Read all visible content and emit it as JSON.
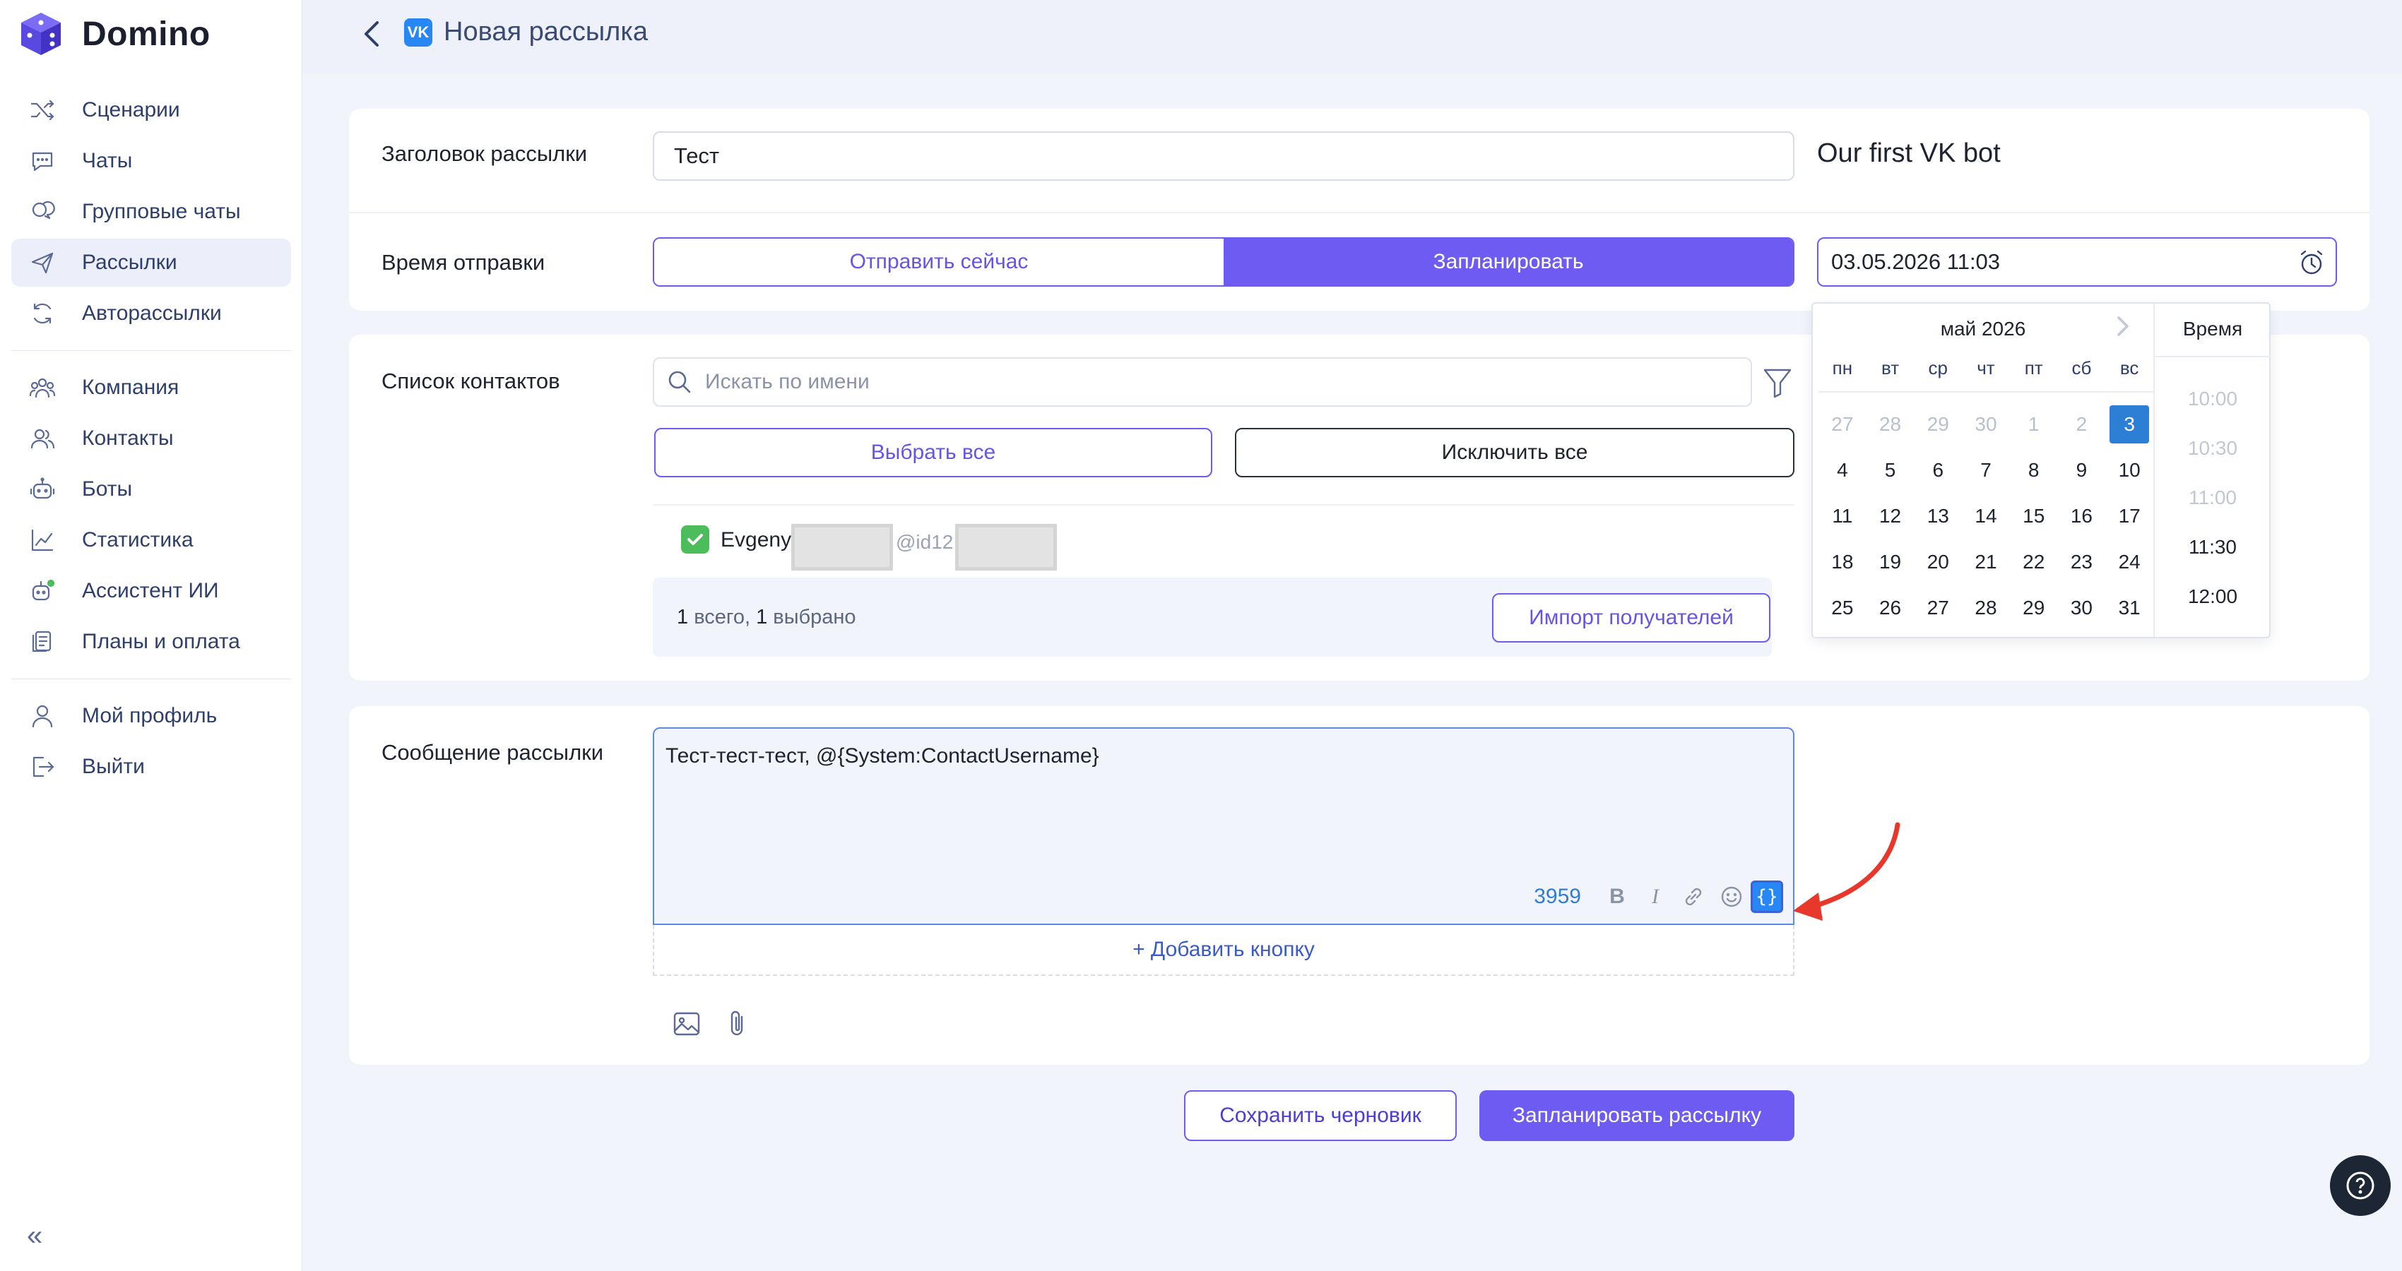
{
  "app": {
    "name": "Domino"
  },
  "sidebar": {
    "items": [
      {
        "label": "Сценарии",
        "icon": "shuffle-icon"
      },
      {
        "label": "Чаты",
        "icon": "chat-icon"
      },
      {
        "label": "Групповые чаты",
        "icon": "group-chat-icon"
      },
      {
        "label": "Рассылки",
        "icon": "send-icon",
        "active": true
      },
      {
        "label": "Авторассылки",
        "icon": "auto-send-icon"
      },
      {
        "label": "Компания",
        "icon": "company-icon"
      },
      {
        "label": "Контакты",
        "icon": "contacts-icon"
      },
      {
        "label": "Боты",
        "icon": "bot-icon"
      },
      {
        "label": "Статистика",
        "icon": "stats-icon"
      },
      {
        "label": "Ассистент ИИ",
        "icon": "ai-assistant-icon"
      },
      {
        "label": "Планы и оплата",
        "icon": "billing-icon"
      },
      {
        "label": "Мой профиль",
        "icon": "profile-icon"
      },
      {
        "label": "Выйти",
        "icon": "logout-icon"
      }
    ]
  },
  "header": {
    "title": "Новая рассылка",
    "badge": "VK"
  },
  "form": {
    "title_label": "Заголовок рассылки",
    "title_value": "Тест",
    "bot_name": "Our first VK bot",
    "time_label": "Время отправки",
    "send_now": "Отправить сейчас",
    "schedule": "Запланировать",
    "datetime": "03.05.2026 11:03",
    "contacts_label": "Список контактов",
    "search_placeholder": "Искать по имени",
    "select_all": "Выбрать все",
    "exclude_all": "Исключить все",
    "contact": {
      "name": "Evgeny",
      "handle": "@id12"
    },
    "summary_total": "1",
    "summary_total_text": " всего, ",
    "summary_selected": "1",
    "summary_selected_text": " выбрано",
    "import": "Импорт получателей",
    "message_label": "Сообщение рассылки",
    "message_text": "Тест-тест-тест, @{System:ContactUsername}",
    "char_counter": "3959",
    "add_button": "+ Добавить кнопку",
    "save_draft": "Сохранить черновик",
    "schedule_mailing": "Запланировать рассылку"
  },
  "calendar": {
    "month": "май 2026",
    "dows": [
      "пн",
      "вт",
      "ср",
      "чт",
      "пт",
      "сб",
      "вс"
    ],
    "days": [
      {
        "d": "27",
        "m": true
      },
      {
        "d": "28",
        "m": true
      },
      {
        "d": "29",
        "m": true
      },
      {
        "d": "30",
        "m": true
      },
      {
        "d": "1",
        "m": true
      },
      {
        "d": "2",
        "m": true
      },
      {
        "d": "3",
        "sel": true
      },
      {
        "d": "4"
      },
      {
        "d": "5"
      },
      {
        "d": "6"
      },
      {
        "d": "7"
      },
      {
        "d": "8"
      },
      {
        "d": "9"
      },
      {
        "d": "10"
      },
      {
        "d": "11"
      },
      {
        "d": "12"
      },
      {
        "d": "13"
      },
      {
        "d": "14"
      },
      {
        "d": "15"
      },
      {
        "d": "16"
      },
      {
        "d": "17"
      },
      {
        "d": "18"
      },
      {
        "d": "19"
      },
      {
        "d": "20"
      },
      {
        "d": "21"
      },
      {
        "d": "22"
      },
      {
        "d": "23"
      },
      {
        "d": "24"
      },
      {
        "d": "25"
      },
      {
        "d": "26"
      },
      {
        "d": "27"
      },
      {
        "d": "28"
      },
      {
        "d": "29"
      },
      {
        "d": "30"
      },
      {
        "d": "31"
      }
    ],
    "time_header": "Время",
    "times": [
      {
        "t": "10:00",
        "m": true
      },
      {
        "t": "10:30",
        "m": true
      },
      {
        "t": "11:00",
        "m": true
      },
      {
        "t": "11:30"
      },
      {
        "t": "12:00"
      }
    ]
  },
  "colors": {
    "accent": "#6e5cf2",
    "selected_day": "#2d7fd6",
    "check": "#4bbd5a",
    "annotation": "#e8382b"
  }
}
